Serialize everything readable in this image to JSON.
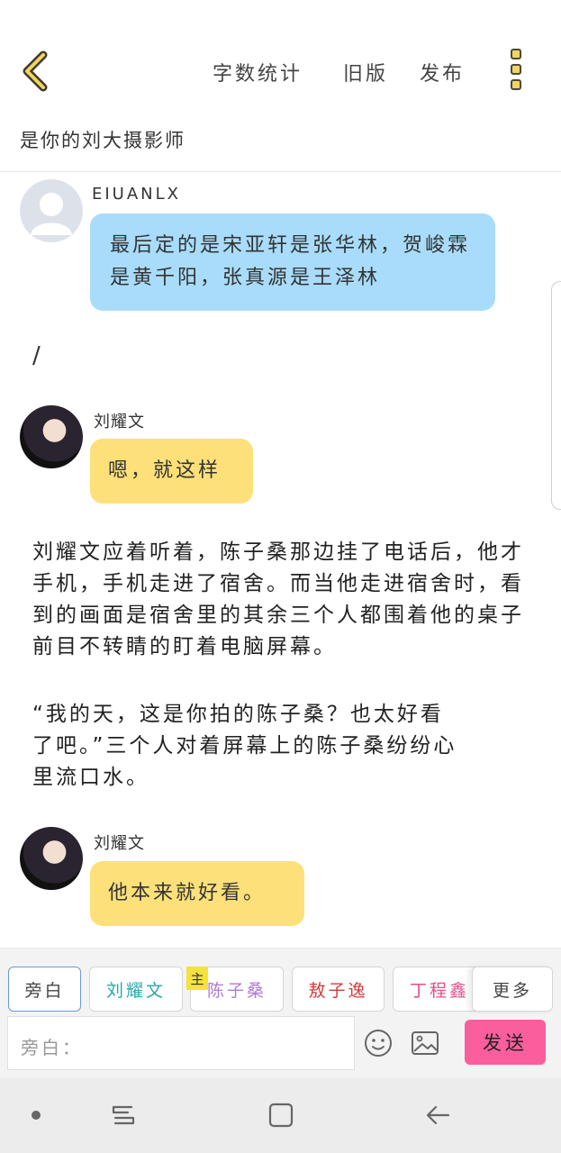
{
  "header": {
    "word_count_label": "字数统计",
    "old_version_label": "旧版",
    "publish_label": "发布"
  },
  "story_title": "是你的刘大摄影师",
  "messages": [
    {
      "sender": "EIUANLX",
      "text": "最后定的是宋亚轩是张华林，贺峻霖是黄千阳，张真源是王泽林"
    },
    {
      "sender": "刘耀文",
      "text": "嗯，就这样"
    },
    {
      "sender": "刘耀文",
      "text": "他本来就好看。"
    }
  ],
  "slash_text": "/",
  "narration": [
    "刘耀文应着听着，陈子桑那边挂了电话后，他才手机，手机走进了宿舍。而当他走进宿舍时，看到的画面是宿舍里的其余三个人都围着他的桌子前目不转睛的盯着电脑屏幕。",
    "“我的天，这是你拍的陈子桑？也太好看了吧。”三个人对着屏幕上的陈子桑纷纷心里流口水。"
  ],
  "roles": [
    {
      "label": "旁白",
      "color": "#444444"
    },
    {
      "label": "刘耀文",
      "color": "#2aa8a8"
    },
    {
      "label": "陈子桑",
      "color": "#b07ad6"
    },
    {
      "label": "敖子逸",
      "color": "#d23b3b"
    },
    {
      "label": "丁程鑫",
      "color": "#e0508a"
    }
  ],
  "more_label": "更多",
  "host_badge": "主",
  "input": {
    "placeholder": "旁白："
  },
  "send_label": "发送",
  "colors": {
    "accent_yellow": "#fde07a",
    "bubble_blue": "#a8dcfa",
    "send_pink": "#fb5e9c"
  },
  "icons": [
    "back-arrow-icon",
    "more-vertical-icon",
    "emoji-icon",
    "image-icon",
    "recent-apps-icon",
    "home-icon",
    "nav-back-icon"
  ]
}
